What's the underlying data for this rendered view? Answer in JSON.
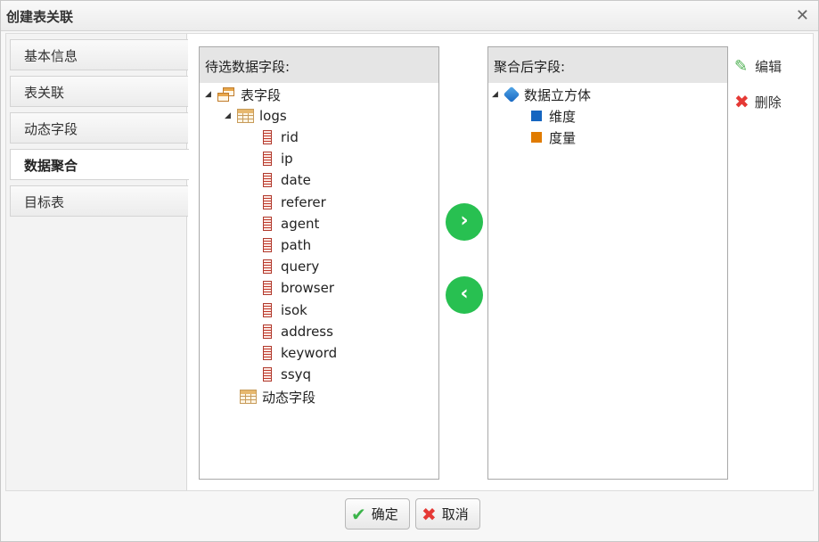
{
  "dialog": {
    "title": "创建表关联"
  },
  "sidebar": {
    "items": [
      {
        "label": "基本信息"
      },
      {
        "label": "表关联"
      },
      {
        "label": "动态字段"
      },
      {
        "label": "数据聚合"
      },
      {
        "label": "目标表"
      }
    ],
    "active_index": 3
  },
  "left_panel": {
    "header": "待选数据字段:",
    "root": "表字段",
    "table": "logs",
    "fields": [
      "rid",
      "ip",
      "date",
      "referer",
      "agent",
      "path",
      "query",
      "browser",
      "isok",
      "address",
      "keyword",
      "ssyq"
    ],
    "dynamic": "动态字段"
  },
  "right_panel": {
    "header": "聚合后字段:",
    "root": "数据立方体",
    "children": [
      {
        "label": "维度",
        "color": "#1565c0"
      },
      {
        "label": "度量",
        "color": "#e07b00"
      }
    ]
  },
  "actions": {
    "edit": "编辑",
    "delete": "删除"
  },
  "footer": {
    "ok": "确定",
    "cancel": "取消"
  },
  "colors": {
    "move_button": "#28c051",
    "panel_header": "#e5e5e5"
  }
}
